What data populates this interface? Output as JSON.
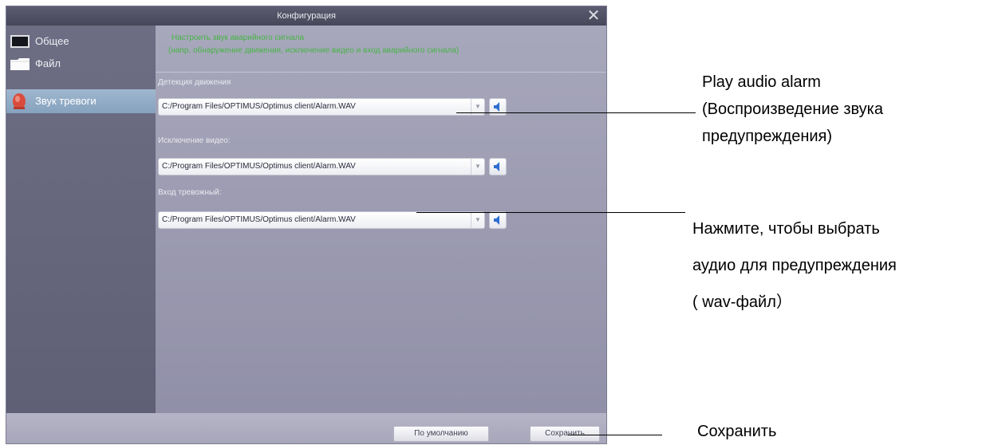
{
  "window": {
    "title": "Конфигурация"
  },
  "sidebar": {
    "items": [
      {
        "label": "Общее",
        "icon": "monitor-icon"
      },
      {
        "label": "Файл",
        "icon": "folder-icon"
      },
      {
        "label": "Звук тревоги",
        "icon": "alarm-bell-icon",
        "active": true
      }
    ]
  },
  "main": {
    "hint_line1": "Настроить звук аварийного сигнала",
    "hint_line2": "(напр. обнаружение движения, исключение видео и вход аварийного сигнала)",
    "fields": [
      {
        "label": "Детекция движения",
        "value": "C:/Program Files/OPTIMUS/Optimus client/Alarm.WAV"
      },
      {
        "label": "Исключение видео:",
        "value": "C:/Program Files/OPTIMUS/Optimus client/Alarm.WAV"
      },
      {
        "label": "Вход тревожный:",
        "value": "C:/Program Files/OPTIMUS/Optimus client/Alarm.WAV"
      }
    ]
  },
  "buttons": {
    "default_label": "По умолчанию",
    "save_label": "Сохранить"
  },
  "annotations": {
    "play_line1": "Play audio alarm",
    "play_line2": "(Воспроизведение звука",
    "play_line3": "предупреждения)",
    "select_line1": "Нажмите, чтобы выбрать",
    "select_line2": "аудио для предупреждения",
    "select_line3": "( wav-файл）",
    "save": "Сохранить"
  },
  "colors": {
    "hint_green": "#47b447",
    "speaker_blue": "#2f6fd1",
    "active_item": "#93adc7"
  }
}
